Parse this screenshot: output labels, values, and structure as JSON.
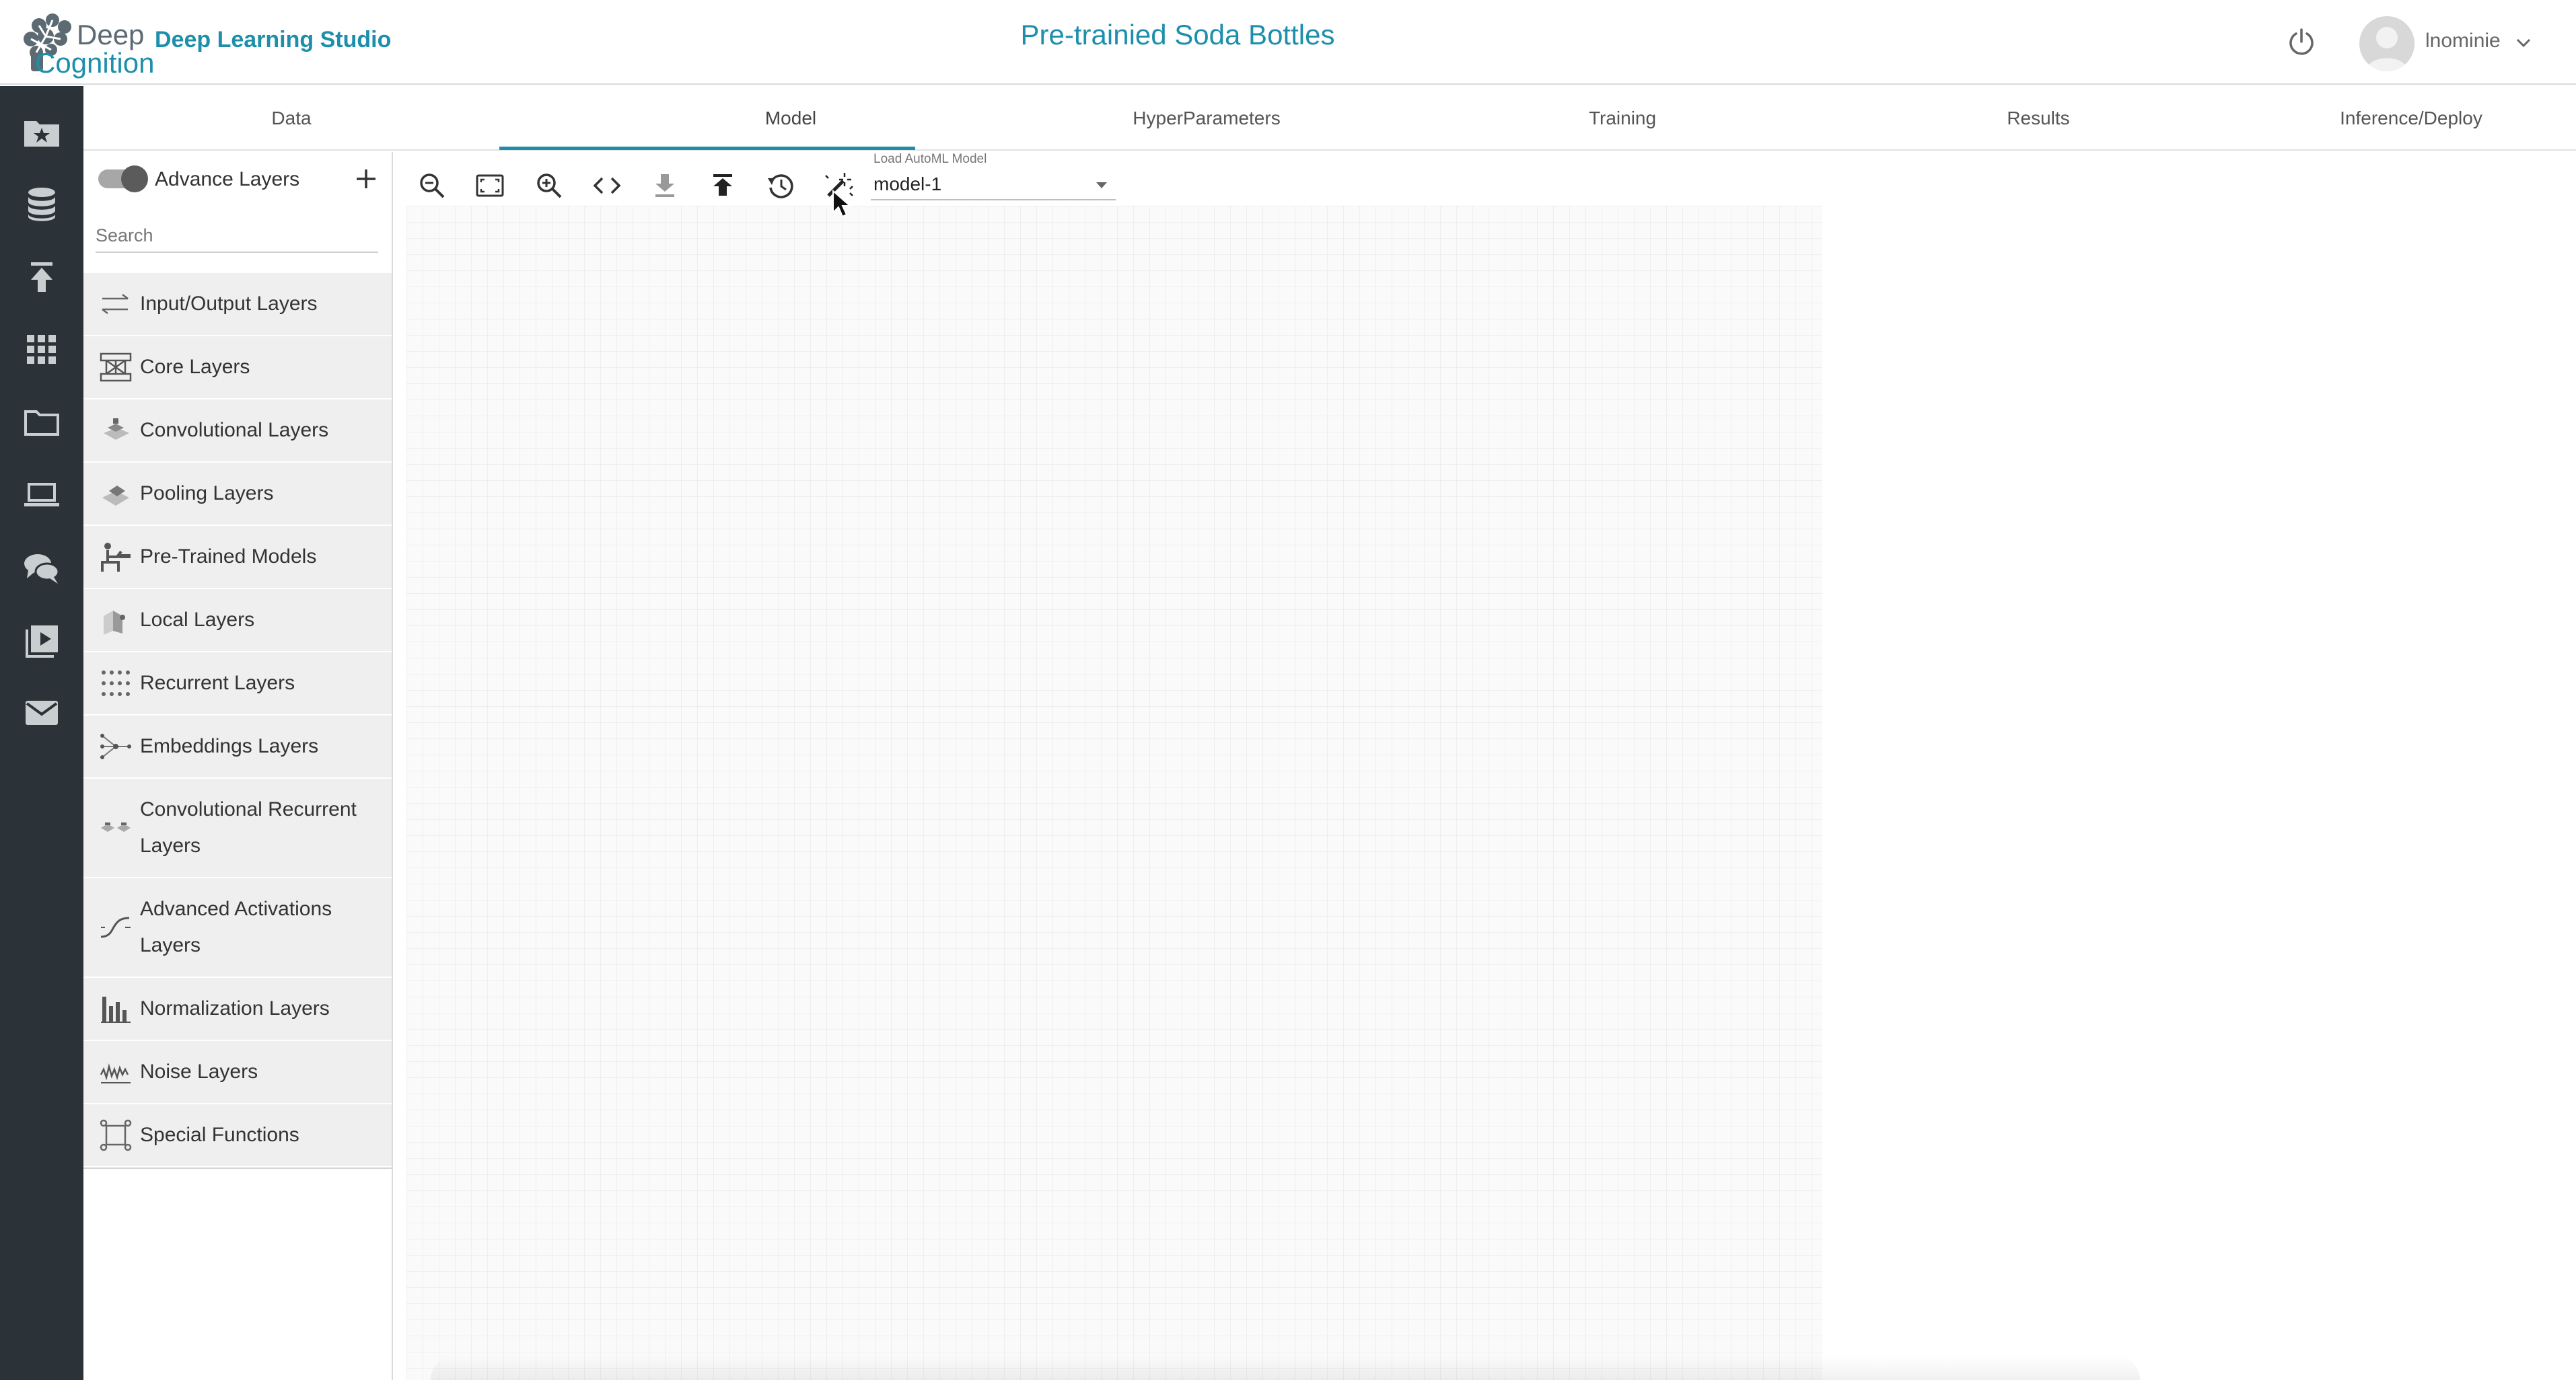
{
  "header": {
    "logo_top": "Deep",
    "logo_bottom": "Cognition",
    "app_name": "Deep Learning Studio",
    "project_title": "Pre-trainied Soda Bottles",
    "username": "lnominie"
  },
  "rail": {
    "items": [
      {
        "icon": "star-folder-icon"
      },
      {
        "icon": "database-icon"
      },
      {
        "icon": "upload-icon"
      },
      {
        "icon": "grid-icon"
      },
      {
        "icon": "folder-icon"
      },
      {
        "icon": "laptop-icon"
      },
      {
        "icon": "chat-icon"
      },
      {
        "icon": "video-icon"
      },
      {
        "icon": "mail-icon"
      }
    ]
  },
  "tabs": [
    {
      "label": "Data"
    },
    {
      "label": "Model",
      "active": true
    },
    {
      "label": "HyperParameters"
    },
    {
      "label": "Training"
    },
    {
      "label": "Results"
    },
    {
      "label": "Inference/Deploy"
    }
  ],
  "panel": {
    "advance_label": "Advance Layers",
    "advance_on": true,
    "search_placeholder": "Search",
    "layers": [
      {
        "label": "Input/Output Layers",
        "icon": "input-output-icon"
      },
      {
        "label": "Core Layers",
        "icon": "core-layers-icon"
      },
      {
        "label": "Convolutional Layers",
        "icon": "convolution-icon"
      },
      {
        "label": "Pooling Layers",
        "icon": "pooling-icon"
      },
      {
        "label": "Pre-Trained Models",
        "icon": "pretrained-icon"
      },
      {
        "label": "Local Layers",
        "icon": "local-layers-icon"
      },
      {
        "label": "Recurrent Layers",
        "icon": "recurrent-icon"
      },
      {
        "label": "Embeddings Layers",
        "icon": "embeddings-icon"
      },
      {
        "label": "Convolutional Recurrent Layers",
        "icon": "conv-recurrent-icon"
      },
      {
        "label": "Advanced Activations Layers",
        "icon": "activation-icon"
      },
      {
        "label": "Normalization Layers",
        "icon": "normalization-icon"
      },
      {
        "label": "Noise Layers",
        "icon": "noise-icon"
      },
      {
        "label": "Special Functions",
        "icon": "special-functions-icon"
      }
    ]
  },
  "toolbar": {
    "tools": [
      {
        "icon": "zoom-out-icon"
      },
      {
        "icon": "fit-screen-icon"
      },
      {
        "icon": "zoom-in-icon"
      },
      {
        "icon": "code-icon"
      },
      {
        "icon": "download-icon"
      },
      {
        "icon": "upload-icon"
      },
      {
        "icon": "history-icon"
      },
      {
        "icon": "automl-wand-icon"
      }
    ],
    "automl_label": "Load AutoML Model",
    "automl_value": "model-1"
  },
  "colors": {
    "accent": "#1d8fab",
    "rail_bg": "#2b3338",
    "panel_item_bg": "#efefef"
  }
}
